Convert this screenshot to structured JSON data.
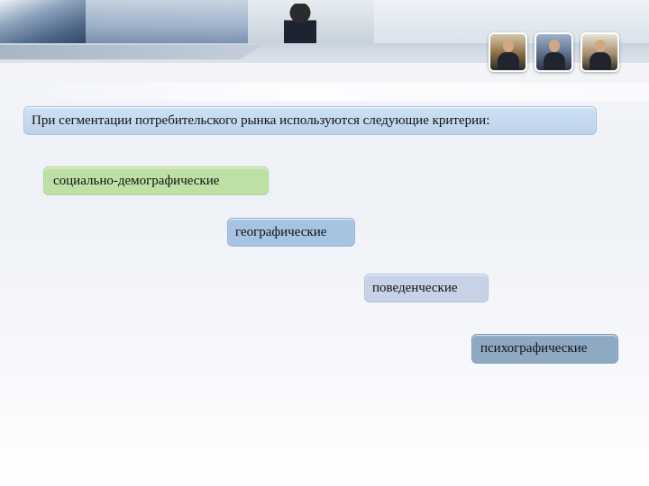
{
  "header": {
    "banner_icon": "business-photo-banner",
    "thumbnail_icons": [
      "business-meeting-photo",
      "business-people-photo",
      "businessman-photo"
    ]
  },
  "slide": {
    "title": "При сегментации потребительского рынка используются следующие критерии:",
    "criteria": [
      {
        "label": "социально-демографические",
        "color": "#bfe0a4"
      },
      {
        "label": "географические",
        "color": "#a6c3e2"
      },
      {
        "label": "поведенческие",
        "color": "#c6d3e6"
      },
      {
        "label": "психографические",
        "color": "#8ea9c4"
      }
    ]
  }
}
